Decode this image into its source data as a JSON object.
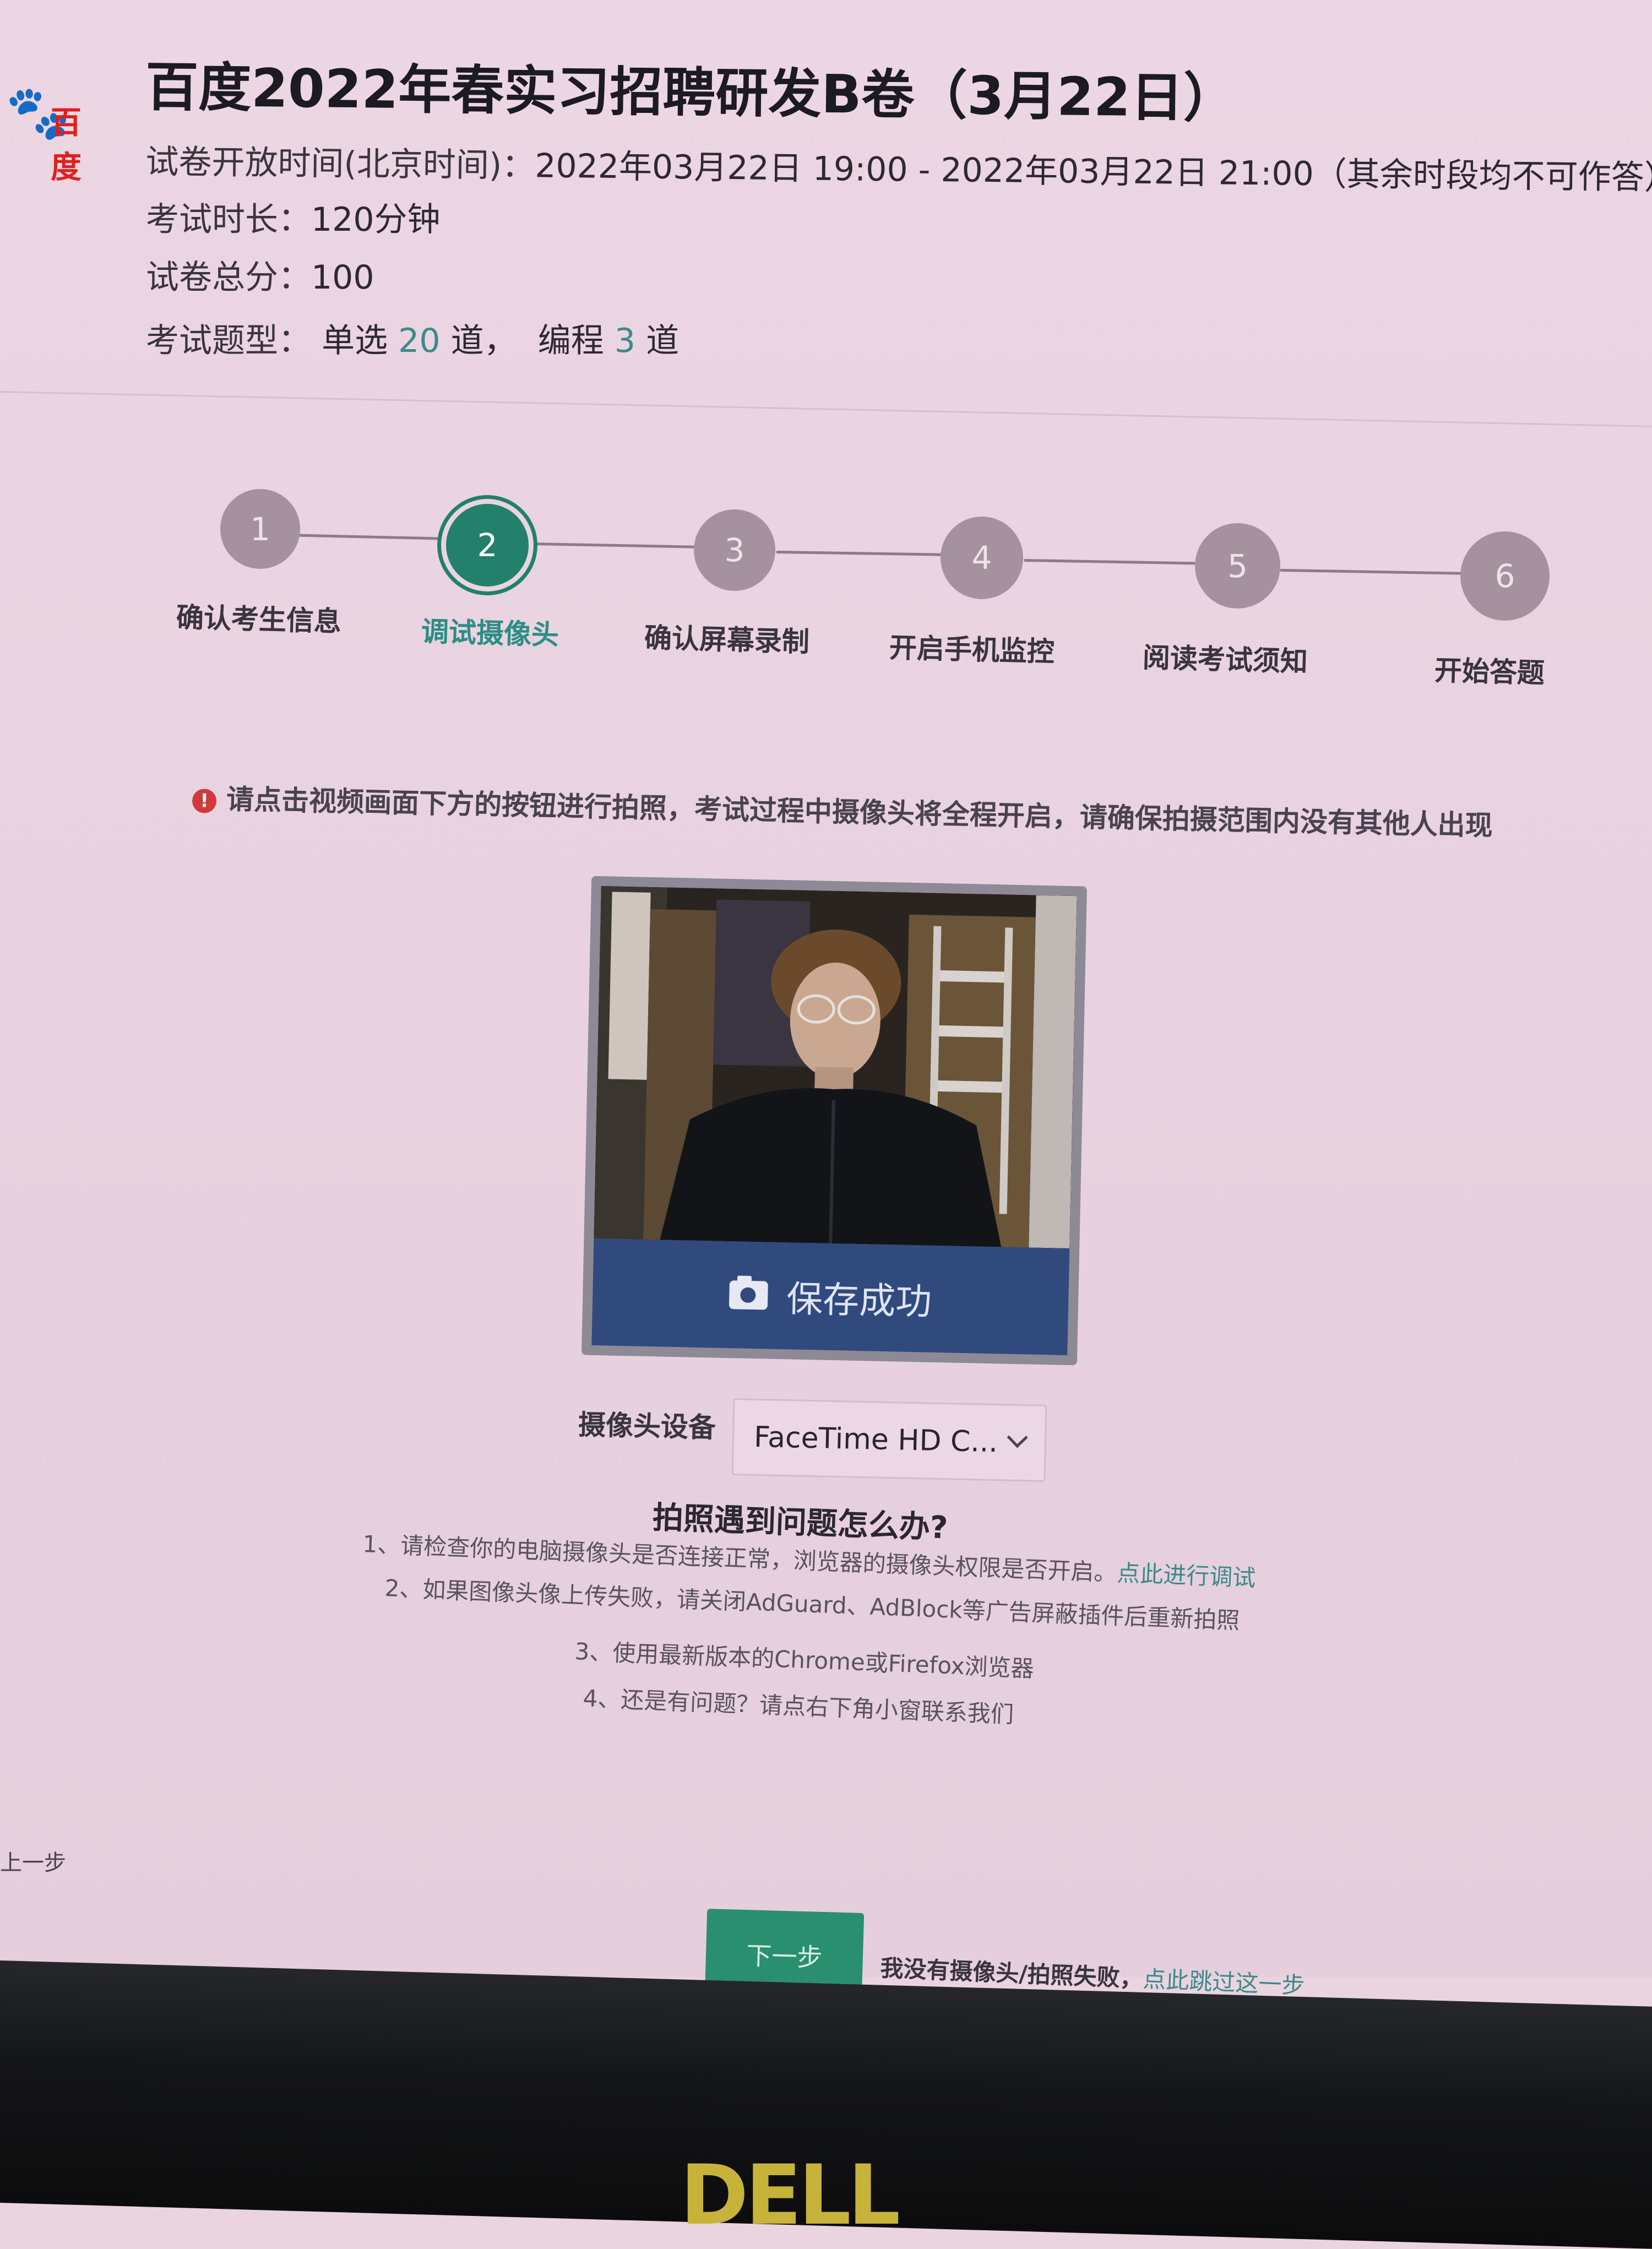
{
  "header": {
    "logo_text": "百度",
    "title": "百度2022年春实习招聘研发B卷（3月22日）",
    "open_time_label": "试卷开放时间(北京时间)：",
    "open_time_value": "2022年03月22日 19:00 - 2022年03月22日 21:00（其余时段均不可作答）",
    "duration_label": "考试时长：",
    "duration_value": "120分钟",
    "total_label": "试卷总分：",
    "total_value": "100",
    "types_label": "考试题型：",
    "types_single_prefix": "单选",
    "types_single_count": "20",
    "types_single_suffix": "道，",
    "types_code_prefix": "编程",
    "types_code_count": "3",
    "types_code_suffix": "道"
  },
  "steps": [
    {
      "num": "1",
      "label": "确认考生信息"
    },
    {
      "num": "2",
      "label": "调试摄像头"
    },
    {
      "num": "3",
      "label": "确认屏幕录制"
    },
    {
      "num": "4",
      "label": "开启手机监控"
    },
    {
      "num": "5",
      "label": "阅读考试须知"
    },
    {
      "num": "6",
      "label": "开始答题"
    }
  ],
  "notice": {
    "icon": "!",
    "text": "请点击视频画面下方的按钮进行拍照，考试过程中摄像头将全程开启，请确保拍摄范围内没有其他人出现"
  },
  "camera": {
    "save_label": "保存成功",
    "device_label": "摄像头设备",
    "device_value": "FaceTime HD C..."
  },
  "faq": {
    "title": "拍照遇到问题怎么办?",
    "item1": "1、请检查你的电脑摄像头是否连接正常，浏览器的摄像头权限是否开启。",
    "item1_link": "点此进行调试",
    "item2": "2、如果图像头像上传失败，请关闭AdGuard、AdBlock等广告屏蔽插件后重新拍照",
    "item3": "3、使用最新版本的Chrome或Firefox浏览器",
    "item4": "4、还是有问题？请点右下角小窗联系我们"
  },
  "footer": {
    "prev_label": "上一步",
    "next_label": "下一步",
    "skip_text": "我没有摄像头/拍照失败，",
    "skip_link": "点此跳过这一步"
  },
  "monitor": {
    "brand": "DELL"
  },
  "colors": {
    "accent": "#22806d",
    "save_bar": "#304a7e",
    "link": "#3d8a8a"
  }
}
